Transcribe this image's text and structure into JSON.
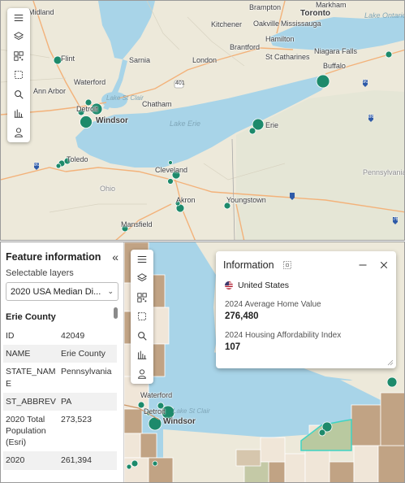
{
  "top_map": {
    "labels": {
      "midland": "Midland",
      "flint": "Flint",
      "sarnia": "Sarnia",
      "london": "London",
      "waterford": "Waterford",
      "ann_arbor": "Ann Arbor",
      "detroit": "Detroit",
      "windsor": "Windsor",
      "lake_st_clair": "Lake St Clair",
      "chatham": "Chatham",
      "lake_erie": "Lake Erie",
      "toledo": "Toledo",
      "ohio": "Ohio",
      "cleveland": "Cleveland",
      "akron": "Akron",
      "youngstown": "Youngstown",
      "mansfield": "Mansfield",
      "kitchener": "Kitchener",
      "brantford": "Brantford",
      "hamilton": "Hamilton",
      "st_catharines": "St Catharines",
      "niagara_falls": "Niagara Falls",
      "buffalo": "Buffalo",
      "brampton": "Brampton",
      "toronto": "Toronto",
      "markham": "Markham",
      "oakville": "Oakville",
      "mississauga": "Mississauga",
      "lake_ontario": "Lake Ontario",
      "erie": "Erie",
      "pennsylvania": "Pennsylvania",
      "hwy_401": "401",
      "hwy_80": "80",
      "hwy_90": "90",
      "hwy_86": "86",
      "hwy_76": "76"
    }
  },
  "bottom_map": {
    "labels": {
      "waterford": "Waterford",
      "lake_st_clair": "Lake St Clair",
      "detroit": "Detroit",
      "windsor": "Windsor"
    }
  },
  "toolbar_icons": [
    "menu-icon",
    "layers-icon",
    "qr-icon",
    "select-icon",
    "search-icon",
    "chart-icon",
    "user-icon"
  ],
  "feature_panel": {
    "title": "Feature information",
    "collapse_glyph": "«",
    "selectable_label": "Selectable layers",
    "selected_layer": "2020 USA Median Di...",
    "layer_title": "Erie County",
    "rows": [
      {
        "key": "ID",
        "value": "42049"
      },
      {
        "key": "NAME",
        "value": "Erie County"
      },
      {
        "key": "STATE_NAME",
        "value": "Pennsylvania"
      },
      {
        "key": "ST_ABBREV",
        "value": "PA"
      },
      {
        "key": "2020 Total Population (Esri)",
        "value": "273,523"
      },
      {
        "key": "2020",
        "value": "261,394"
      }
    ]
  },
  "info_popup": {
    "title": "Information",
    "country": "United States",
    "field1_label": "2024 Average Home Value",
    "field1_value": "276,480",
    "field2_label": "2024 Housing Affordability Index",
    "field2_value": "107"
  },
  "colors": {
    "water": "#a8d4e8",
    "land": "#ede9da",
    "marker": "#1d8a6b",
    "choropleth_brown": "#c1a384",
    "choropleth_beige": "#f0e6d8",
    "highlight": "#3fd4c4"
  }
}
